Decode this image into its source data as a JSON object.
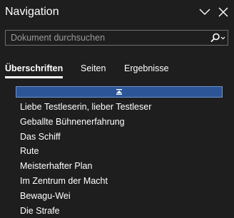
{
  "panel": {
    "title": "Navigation",
    "collapse_icon": "chevron-down-icon",
    "close_icon": "close-icon"
  },
  "search": {
    "placeholder": "Dokument durchsuchen",
    "button_icon": "search-icon"
  },
  "tabs": [
    {
      "label": "Überschriften",
      "active": true
    },
    {
      "label": "Seiten",
      "active": false
    },
    {
      "label": "Ergebnisse",
      "active": false
    }
  ],
  "collapse_bar": {
    "icon": "collapse-up-icon"
  },
  "headings": [
    "Liebe Testleserin, lieber Testleser",
    "Geballte Bühnenerfahrung",
    "Das Schiff",
    "Rute",
    "Meisterhafter Plan",
    "Im Zentrum der Macht",
    "Bewagu-Wei",
    "Die Strafe"
  ],
  "colors": {
    "background": "#1e1e1e",
    "selection_bar": "#2b5597",
    "text": "#ffffff",
    "placeholder": "#9a9a9a"
  }
}
